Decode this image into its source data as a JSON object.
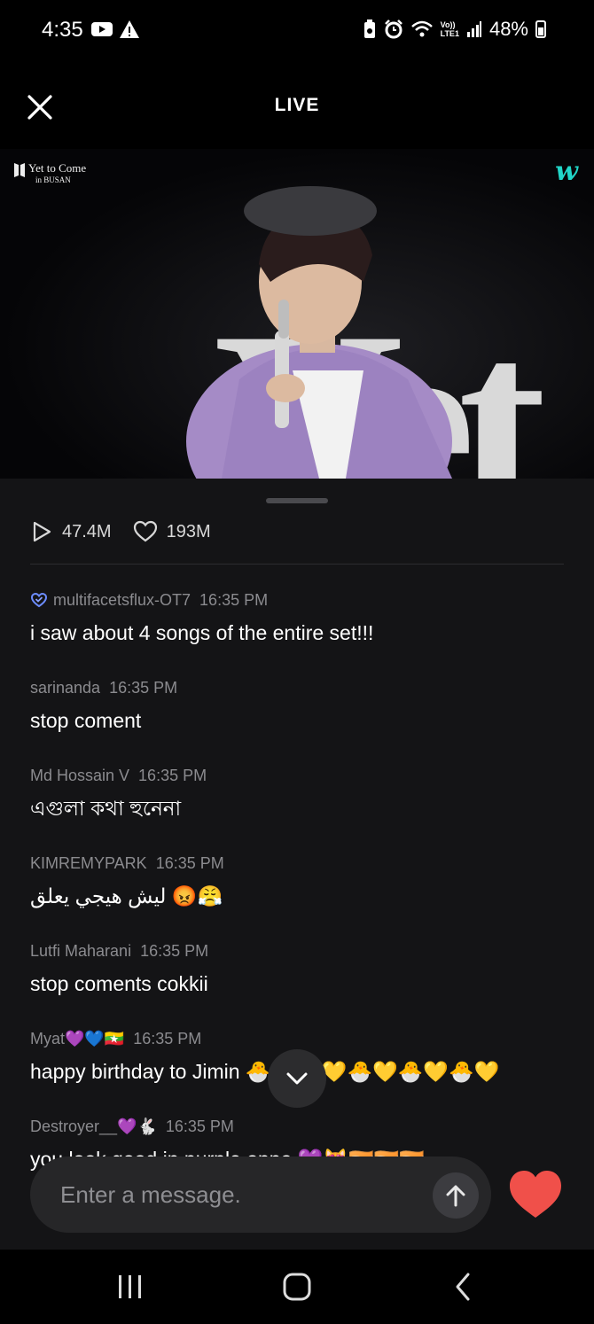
{
  "status_bar": {
    "time": "4:35",
    "battery_percent": "48%",
    "network_label_top": "Vo))",
    "network_label_bottom": "LTE1",
    "icons": [
      "youtube-icon",
      "alert-icon",
      "battery-saver-icon",
      "alarm-icon",
      "wifi-icon",
      "volte-icon",
      "signal-icon",
      "battery-icon"
    ]
  },
  "header": {
    "title": "LIVE",
    "close_icon": "close-icon"
  },
  "video": {
    "overlay_logo_line1": "Yet to Come",
    "overlay_logo_line2": "in BUSAN",
    "brand_mark": "w",
    "stage_text": "Yet",
    "progress": 1.0,
    "accent_color": "#1fd6c4"
  },
  "stats": {
    "views": "47.4M",
    "likes": "193M"
  },
  "chat": [
    {
      "user": "multifacetsflux-OT7",
      "time": "16:35 PM",
      "text": "i saw about 4 songs of the entire set!!!",
      "badge": true
    },
    {
      "user": "sarinanda",
      "time": "16:35 PM",
      "text": "stop coment"
    },
    {
      "user": "Md Hossain V",
      "time": "16:35 PM",
      "text": "এগুলা কথা হুনেনা"
    },
    {
      "user": "KIMREMYPARK",
      "time": "16:35 PM",
      "text": "ليش هيجي يعلق 😡😤"
    },
    {
      "user": "Lutfi Maharani",
      "time": "16:35 PM",
      "text": "stop coments cokkii"
    },
    {
      "user": "Myat💜💙🇲🇲",
      "time": "16:35 PM",
      "text": "happy birthday to Jimin 🐣🐇🐣💛🐣💛🐣💛🐣💛"
    },
    {
      "user": "Destroyer__💜🐇",
      "time": "16:35 PM",
      "text": "you look good in purple oppa 💜😻🇮🇳🇮🇳🇮🇳"
    }
  ],
  "composer": {
    "placeholder": "Enter a message.",
    "like_color": "#f0504a"
  },
  "nav": {
    "items": [
      "recent-apps-icon",
      "home-icon",
      "back-icon"
    ]
  }
}
